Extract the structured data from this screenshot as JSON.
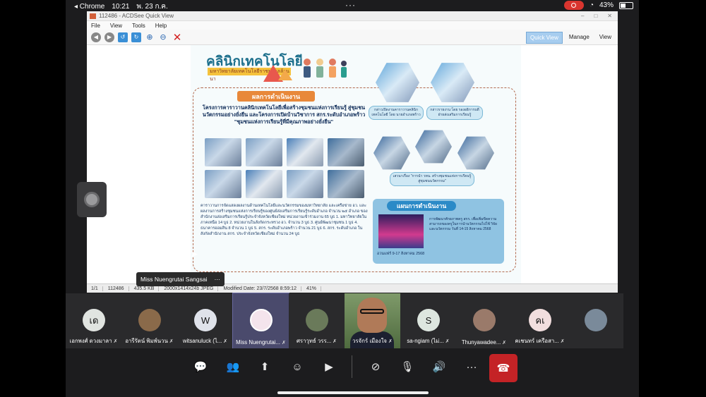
{
  "status_bar": {
    "app": "◂ Chrome",
    "time": "10:21",
    "date": "พ. 23 ก.ค.",
    "battery": "43%"
  },
  "window": {
    "title": "112486 - ACDSee Quick View",
    "menu": [
      "File",
      "View",
      "Tools",
      "Help"
    ],
    "view_tabs": [
      "Quick View",
      "Manage",
      "View"
    ],
    "status": [
      "1/1",
      "112486",
      "435.5 KB",
      "2000x1414x24b JPEG",
      "Modified Date: 23/7/2568 8:59:12",
      "41%"
    ]
  },
  "poster": {
    "title": "คลินิกเทคโนโลยี",
    "subtitle": "มหาวิทยาลัยเทคโนโลยีราชมงคลล้านนา",
    "section_head": "ผลการดำเนินงาน",
    "project_text": "โครงการคาราวานคลินิกเทคโนโลยีเพื่อสร้างชุมชนแห่งการเรียนรู้ สู่ชุมชนนวัตกรรมอย่างยั่งยืน และโครงการเปิดบ้านวิชาการ สกร.ระดับอำเภอพร้าว \"ชุมชนแห่งการเรียนรู้ที่มีคุณภาพอย่างยั่งยืน\"",
    "body_text": "คาราวานการจัดแสดงผลงานด้านเทคโนโลยีและนวัตกรรมของมหาวิทยาลัย และเครือข่าย อว. และผลงานการสร้างชุมชนแห่งการเรียนรู้ของศูนย์ส่งเสริมการเรียนรู้ระดับอำเภอ จำนวน ๒๕ อำเภอ ของสำนักงานส่งเสริมการเรียนรู้ประจำจังหวัดเชียงใหม่ หน่วยงานเข้าร่วมงาน 65 บูธ 1. มหาวิทยาลัยในภาคเหนือ 14 บูธ 2. หน่วยงานในสังกัดกระทรวง อว. จำนวน 3 บูธ 3. ศูนย์พัฒนาชุมชน 1 บูธ 4. ธนาคารออมสิน 8 จำนวน 1 บูธ 5. สกร. ระดับอำเภอพร้าว จำนวน 21 บูธ 6. สกร. ระดับอำเภอ ในสังกัดสำนักงาน สกร. ประจำจังหวัดเชียงใหม่ จำนวน 24 บูธ",
    "caption1": "กล่าวเปิดงานคาราวานคลินิกเทคโนโลยี โดย นายอำเภอพร้าว",
    "caption2": "กล่าวรายงาน โดย รองอธิการบดีฝ่ายส่งเสริมการเรียนรู้",
    "caption3": "เสวนาเรื่อง \"การนำ วทน. สร้างชุมชนแห่งการเรียนรู้ สู่ชุมชนนวัตกรรม\"",
    "plan_head": "แผนการดำเนินงาน",
    "plan_date": "อวนแฟร์ 9-17 สิงหาคม 2568",
    "plan_text": "การพัฒนาศักยภาพครู สกร. เพื่อเพิ่มขีดความสามารถของครูในการนำนวัตกรรมไปใช้ วิจัยและนวัตกรรม วันที่ 14-15 สิงหาคม 2568"
  },
  "presenter_tag": {
    "name": "Miss Nuengrutai  Sangsai",
    "more": "···"
  },
  "participants": [
    {
      "initial": "เด",
      "name": "เอกพงศ์ ดวงมาลา",
      "color": "#e0e4e0"
    },
    {
      "initial": "",
      "name": "อารีรัตน์ พิมพ์นวน",
      "color": "#8a6a4a"
    },
    {
      "initial": "W",
      "name": "witsanuluck (ไ...",
      "color": "#dfe2ea"
    },
    {
      "initial": "",
      "name": "Miss Nuengrutai...",
      "color": "#f4e4ec"
    },
    {
      "initial": "",
      "name": "ศราวุทธ์  วรร...",
      "color": "#6a7a5a"
    },
    {
      "initial": "",
      "name": "วรจักร์ เมืองใจ",
      "color": ""
    },
    {
      "initial": "S",
      "name": "sa-ngiam (ไม่...",
      "color": "#dde6df"
    },
    {
      "initial": "",
      "name": "Thunyawadee...",
      "color": "#9a7a6a"
    },
    {
      "initial": "คเ",
      "name": "คเชนทร์ เครือสา...",
      "color": "#f2dede"
    },
    {
      "initial": "",
      "name": "",
      "color": "#7a8a9a"
    }
  ],
  "controls": {
    "chat": "chat-icon",
    "participants": "people-icon",
    "share": "share-screen-icon",
    "reactions": "reaction-icon",
    "apps": "apps-icon",
    "video": "video-off-icon",
    "mic": "mic-off-icon",
    "speaker": "speaker-icon",
    "more": "···",
    "leave": "leave-icon"
  }
}
